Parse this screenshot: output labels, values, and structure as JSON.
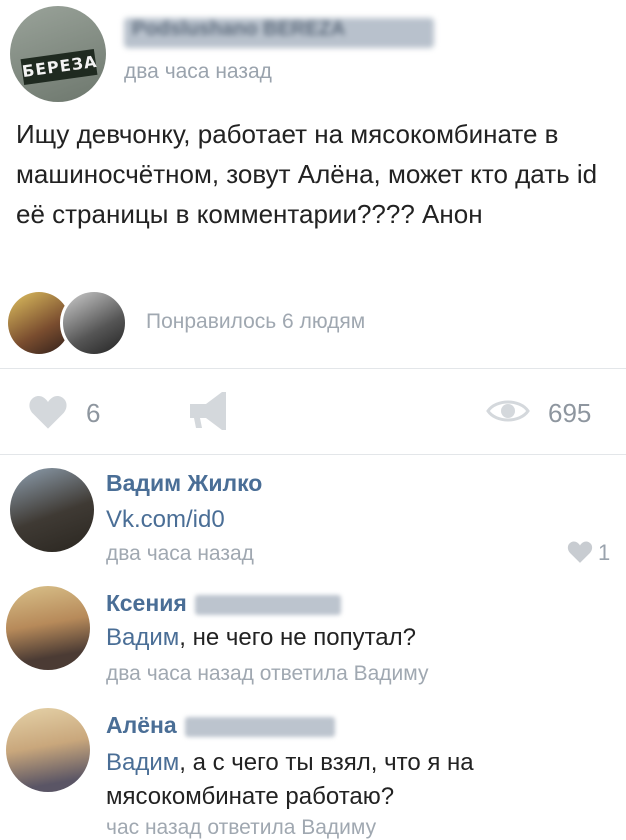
{
  "post": {
    "author_name": "Podslushano BEREZA",
    "avatar_logo": "БЕРЕЗА",
    "time": "два часа назад",
    "text": "Ищу девчонку, работает на мясокомбинате в машиносчётном, зовут Алёна, может кто дать id её страницы в комментарии???? Анон",
    "likes_text": "Понравилось 6 людям",
    "like_count": "6",
    "views": "695"
  },
  "comments": [
    {
      "name": "Вадим Жилко",
      "text": "Vk.com/id0",
      "meta": "два часа назад",
      "like_count": "1"
    },
    {
      "name": "Ксения",
      "mention": "Вадим",
      "text": ", не чего не попутал?",
      "meta": "два часа назад ответила Вадиму"
    },
    {
      "name": "Алёна",
      "mention": "Вадим",
      "text": ", а с чего ты взял, что я на мясокомбинате работаю?",
      "meta": "час назад ответила Вадиму"
    }
  ],
  "colors": {
    "link": "#4a6e96",
    "muted": "#a0a8b1",
    "icon": "#d4d8dc"
  },
  "icons": [
    "heart-icon",
    "share-icon",
    "eye-icon"
  ]
}
